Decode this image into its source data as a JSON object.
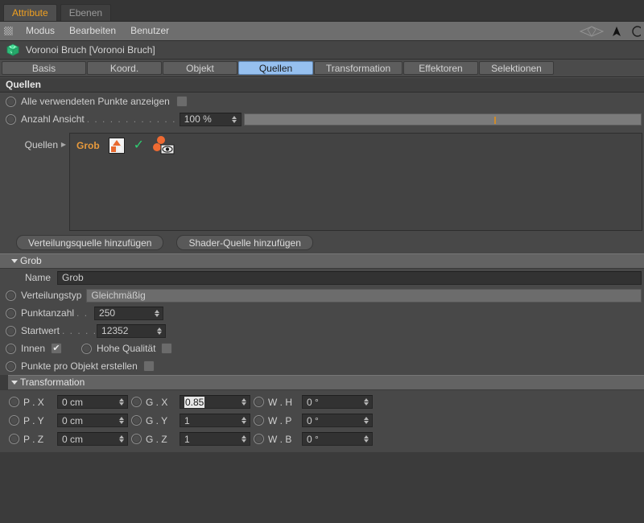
{
  "window": {
    "tabs": [
      {
        "label": "Attribute",
        "active": true
      },
      {
        "label": "Ebenen",
        "active": false
      }
    ],
    "menu": [
      "Modus",
      "Bearbeiten",
      "Benutzer"
    ],
    "accent_orange": "#f0a020",
    "accent_blue": "#96c0ef"
  },
  "object": {
    "name": "Voronoi Bruch [Voronoi Bruch]",
    "icon": "voronoi-cube-icon"
  },
  "attribute_tabs": [
    {
      "label": "Basis",
      "selected": false
    },
    {
      "label": "Koord.",
      "selected": false
    },
    {
      "label": "Objekt",
      "selected": false
    },
    {
      "label": "Quellen",
      "selected": true
    },
    {
      "label": "Transformation",
      "selected": false
    },
    {
      "label": "Effektoren",
      "selected": false
    },
    {
      "label": "Selektionen",
      "selected": false
    }
  ],
  "quellen": {
    "section_title": "Quellen",
    "show_all_points": {
      "label": "Alle verwendeten Punkte anzeigen",
      "checked": false
    },
    "count_view": {
      "label": "Anzahl Ansicht",
      "dots": ". . . . . . . . . . . . . . . . . .",
      "value": "100 %",
      "slider_percent": 63
    },
    "list_label": "Quellen",
    "items": [
      {
        "name": "Grob",
        "thumb_icon": "shader-thumbnail-icon",
        "enabled_icon": "green-check-icon",
        "points_icon": "points-view-icon"
      }
    ],
    "buttons": [
      {
        "label": "Verteilungsquelle hinzufügen"
      },
      {
        "label": "Shader-Quelle hinzufügen"
      }
    ]
  },
  "grob_group": {
    "title": "Grob",
    "name_label": "Name",
    "name_value": "Grob",
    "distribution_type": {
      "label": "Verteilungstyp",
      "value": "Gleichmäßig"
    },
    "point_count": {
      "label": "Punktanzahl",
      "dots": ". .",
      "value": "250"
    },
    "seed": {
      "label": "Startwert",
      "dots": ". . . . .",
      "value": "12352"
    },
    "inside": {
      "label": "Innen",
      "checked": true
    },
    "high_quality": {
      "label": "Hohe Qualität",
      "checked": false
    },
    "points_per_object": {
      "label": "Punkte pro Objekt erstellen",
      "checked": false
    }
  },
  "transformation": {
    "title": "Transformation",
    "rows": [
      {
        "p_label": "P . X",
        "p_value": "0 cm",
        "g_label": "G . X",
        "g_value": "0.85",
        "g_selected": true,
        "w_label": "W . H",
        "w_value": "0 °"
      },
      {
        "p_label": "P . Y",
        "p_value": "0 cm",
        "g_label": "G . Y",
        "g_value": "1",
        "g_selected": false,
        "w_label": "W . P",
        "w_value": "0 °"
      },
      {
        "p_label": "P . Z",
        "p_value": "0 cm",
        "g_label": "G . Z",
        "g_value": "1",
        "g_selected": false,
        "w_label": "W . B",
        "w_value": "0 °"
      }
    ]
  }
}
